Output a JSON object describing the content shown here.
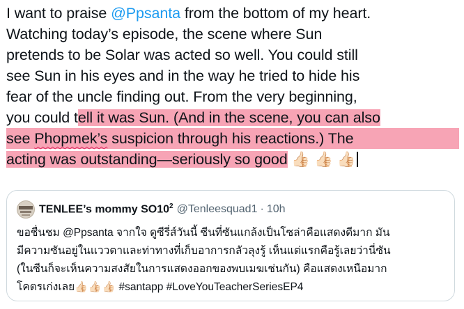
{
  "tweet": {
    "lines": [
      {
        "pre": "I want to praise ",
        "mention": "@Ppsanta",
        "post": " from the bottom of my heart."
      },
      "Watching today’s episode, the scene where Sun",
      "pretends to be Solar was acted so well. You could still",
      "see Sun in his eyes and in the way he tried to hide his",
      "fear of the uncle finding out. From the very beginning,",
      {
        "plain": "you could t",
        "highlight": "ell it was Sun. (And in the scene, you can also"
      },
      {
        "squiggle": "Phopmek’s",
        "rest": " suspicion through his reactions.) The",
        "pre": "see "
      },
      {
        "text": "acting was outstanding—seriously so good",
        "emoji": " 👍🏻  👍🏻  👍🏻"
      }
    ]
  },
  "quote": {
    "avatar_icon": "profile-avatar",
    "display_name": "TENLEE’s mommy SO10",
    "display_name_sup": "2",
    "handle": "@Tenleesquad1",
    "separator": "·",
    "time": "10h",
    "lines": [
      "ขอชื่นชม @Ppsanta จากใจ ดูซีรี่ส์วันนี้ ซีนที่ซันแกล้งเป็นโซล่าคือแสดงดีมาก มัน",
      "มีความซันอยู่ในแววตาและท่าทางที่เก็บอาการกลัวลุงรู้ เห็นแต่แรกคือรู้เลยว่านี่ซัน",
      "(ในซีนก็จะเห็นความสงสัยในการแสดงออกของพบเมฆเช่นกัน) คือแสดงเหนือมาก",
      {
        "text": "โคตรเก่งเลย",
        "emoji": "👍🏻👍🏻👍🏻",
        "tags": " #santapp #LoveYouTeacherSeriesEP4"
      }
    ]
  }
}
